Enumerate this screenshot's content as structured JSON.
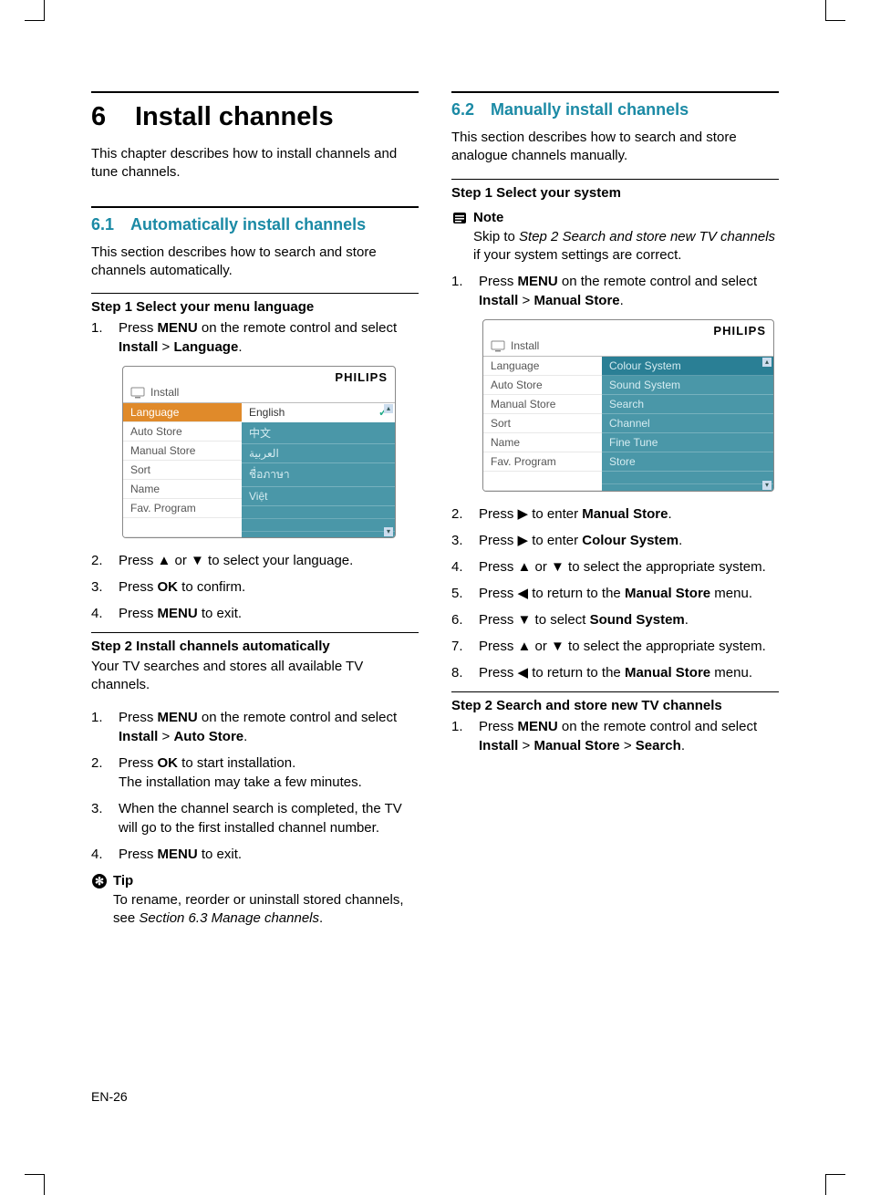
{
  "footer": "EN-26",
  "chapter": {
    "num": "6",
    "title": "Install channels"
  },
  "chapter_intro": "This chapter describes how to install channels and tune channels.",
  "s61": {
    "num": "6.1",
    "title": "Automatically install channels",
    "intro": "This section describes how to search and store channels automatically.",
    "step1_title": "Step 1 Select your menu language",
    "step1_items": [
      {
        "n": "1.",
        "pre": "Press ",
        "b1": "MENU",
        "mid": " on the remote control and select ",
        "b2": "Install",
        "gt": " > ",
        "b3": "Language",
        "post": "."
      }
    ],
    "step1_items2": [
      {
        "n": "2.",
        "t": "Press ▲ or ▼ to select your language."
      },
      {
        "n": "3.",
        "pre": "Press ",
        "b1": "OK",
        "post": " to confirm."
      },
      {
        "n": "4.",
        "pre": "Press ",
        "b1": "MENU",
        "post": " to exit."
      }
    ],
    "step2_title": "Step 2 Install channels automatically",
    "step2_intro": "Your TV searches and stores all available TV channels.",
    "step2_items": [
      {
        "n": "1.",
        "pre": "Press ",
        "b1": "MENU",
        "mid": " on the remote control and select ",
        "b2": "Install",
        "gt": " > ",
        "b3": "Auto Store",
        "post": "."
      },
      {
        "n": "2.",
        "pre": "Press ",
        "b1": "OK",
        "mid": " to start installation.",
        "post2": "The installation may take a few minutes."
      },
      {
        "n": "3.",
        "t": "When the channel search is completed, the TV will go to the first installed channel number."
      },
      {
        "n": "4.",
        "pre": "Press ",
        "b1": "MENU",
        "post": " to exit."
      }
    ],
    "tip_label": "Tip",
    "tip_body_pre": "To rename, reorder or uninstall stored channels, see ",
    "tip_body_ital": "Section 6.3 Manage channels",
    "tip_body_post": "."
  },
  "s62": {
    "num": "6.2",
    "title": "Manually install channels",
    "intro": "This section describes how to search and store analogue channels manually.",
    "step1_title": "Step 1 Select your system",
    "note_label": "Note",
    "note_pre": "Skip to ",
    "note_ital": "Step 2 Search and store new TV channels",
    "note_post": " if your system settings are correct.",
    "step1_items": [
      {
        "n": "1.",
        "pre": "Press ",
        "b1": "MENU",
        "mid": " on the remote control and select ",
        "b2": "Install",
        "gt": " > ",
        "b3": "Manual Store",
        "post": "."
      }
    ],
    "step1_items_after": [
      {
        "n": "2.",
        "pre": "Press ▶ to enter ",
        "b1": "Manual Store",
        "post": "."
      },
      {
        "n": "3.",
        "pre": "Press ▶ to enter ",
        "b1": "Colour System",
        "post": "."
      },
      {
        "n": "4.",
        "t": "Press ▲ or ▼ to select the appropriate system."
      },
      {
        "n": "5.",
        "pre": "Press ◀ to return to the ",
        "b1": "Manual Store",
        "post": " menu."
      },
      {
        "n": "6.",
        "pre": "Press ▼ to select ",
        "b1": "Sound System",
        "post": "."
      },
      {
        "n": "7.",
        "t": "Press ▲ or ▼ to select the appropriate system."
      },
      {
        "n": "8.",
        "pre": "Press ◀ to return to the ",
        "b1": "Manual Store",
        "post": " menu."
      }
    ],
    "step2_title": "Step 2 Search and store new TV channels",
    "step2_items": [
      {
        "n": "1.",
        "pre": "Press ",
        "b1": "MENU",
        "mid": " on the remote control and select ",
        "b2": "Install",
        "gt1": " > ",
        "b3": "Manual Store",
        "gt2": " > ",
        "b4": "Search",
        "post": "."
      }
    ]
  },
  "menu1": {
    "brand": "PHILIPS",
    "title": "Install",
    "left": [
      "Language",
      "Auto Store",
      "Manual Store",
      "Sort",
      "Name",
      "Fav. Program"
    ],
    "right": [
      "English",
      "中文",
      "العربية",
      "ชื่อภาษา",
      "Việt"
    ]
  },
  "menu2": {
    "brand": "PHILIPS",
    "title": "Install",
    "left": [
      "Language",
      "Auto Store",
      "Manual Store",
      "Sort",
      "Name",
      "Fav. Program"
    ],
    "right": [
      "Colour System",
      "Sound System",
      "Search",
      "Channel",
      "Fine Tune",
      "Store"
    ]
  }
}
